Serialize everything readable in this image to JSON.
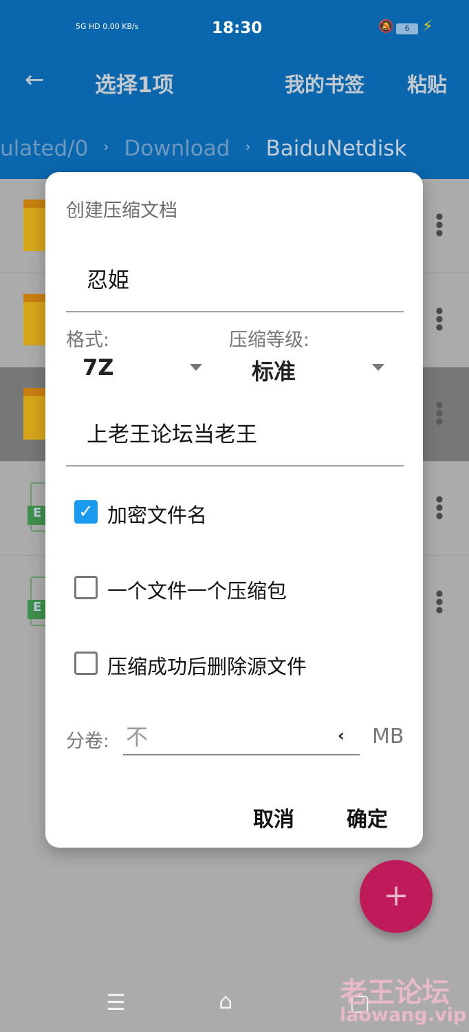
{
  "status_bar": {
    "network": "5G HD",
    "speed": "0.00 KB/s",
    "time": "18:30",
    "battery": "6"
  },
  "toolbar": {
    "back_icon": "arrow-left-icon",
    "title": "选择1项",
    "bookmarks": "我的书签",
    "paste": "粘贴"
  },
  "breadcrumb": {
    "items": [
      "ulated/0",
      "Download",
      "BaiduNetdisk"
    ],
    "sep": "›"
  },
  "dialog": {
    "title": "创建压缩文档",
    "archive_name": "忍姫",
    "format_label": "格式:",
    "format_value": "7Z",
    "level_label": "压缩等级:",
    "level_value": "标准",
    "password": "上老王论坛当老王",
    "options": [
      {
        "label": "加密文件名",
        "checked": true
      },
      {
        "label": "一个文件一个压缩包",
        "checked": false
      },
      {
        "label": "压缩成功后删除源文件",
        "checked": false
      }
    ],
    "split_label": "分卷:",
    "split_placeholder": "不",
    "split_arrow": "‹",
    "split_unit": "MB",
    "cancel": "取消",
    "ok": "确定"
  },
  "fab": {
    "icon": "plus-icon",
    "label": "+"
  },
  "watermark": {
    "line1": "老王论坛",
    "line2": "laowang.vip"
  },
  "colors": {
    "header": "#0a66ad",
    "accent": "#1a9bf0",
    "fab": "#bf1a5a"
  }
}
